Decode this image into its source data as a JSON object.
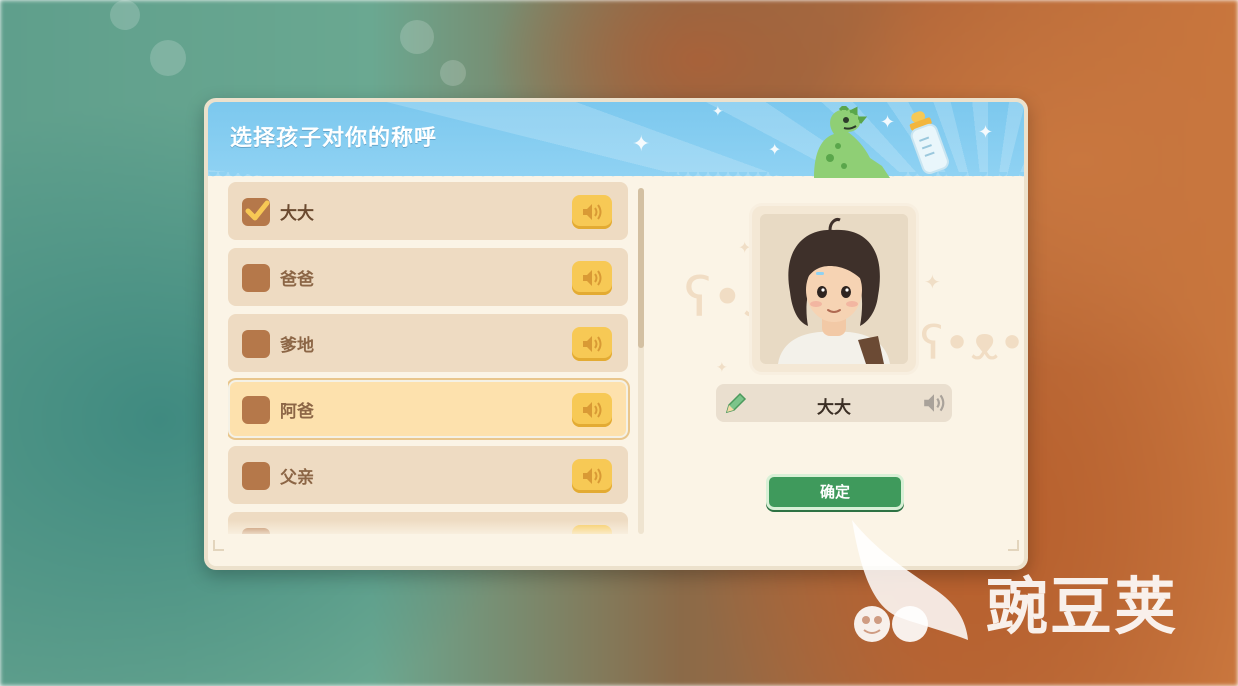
{
  "dialog": {
    "title": "选择孩子对你的称呼"
  },
  "options": [
    {
      "label": "大大",
      "checked": true,
      "active": false
    },
    {
      "label": "爸爸",
      "checked": false,
      "active": false
    },
    {
      "label": "爹地",
      "checked": false,
      "active": false
    },
    {
      "label": "阿爸",
      "checked": false,
      "active": true
    },
    {
      "label": "父亲",
      "checked": false,
      "active": false
    }
  ],
  "preview": {
    "selected_name": "大大"
  },
  "confirm_label": "确定",
  "watermark": {
    "text": "豌豆荚"
  },
  "colors": {
    "header_blue": "#8fd2f3",
    "item_bg": "#eedbc2",
    "item_active_bg": "#fde1ad",
    "checkbox": "#b5784a",
    "sound_button": "#f7c955",
    "confirm_green": "#3f9a5c"
  },
  "icons": [
    "checkmark-icon",
    "speaker-icon",
    "pencil-icon",
    "dinosaur-icon",
    "baby-bottle-icon",
    "sparkle-icon",
    "teddy-bear-icon",
    "watermark-logo-icon"
  ]
}
